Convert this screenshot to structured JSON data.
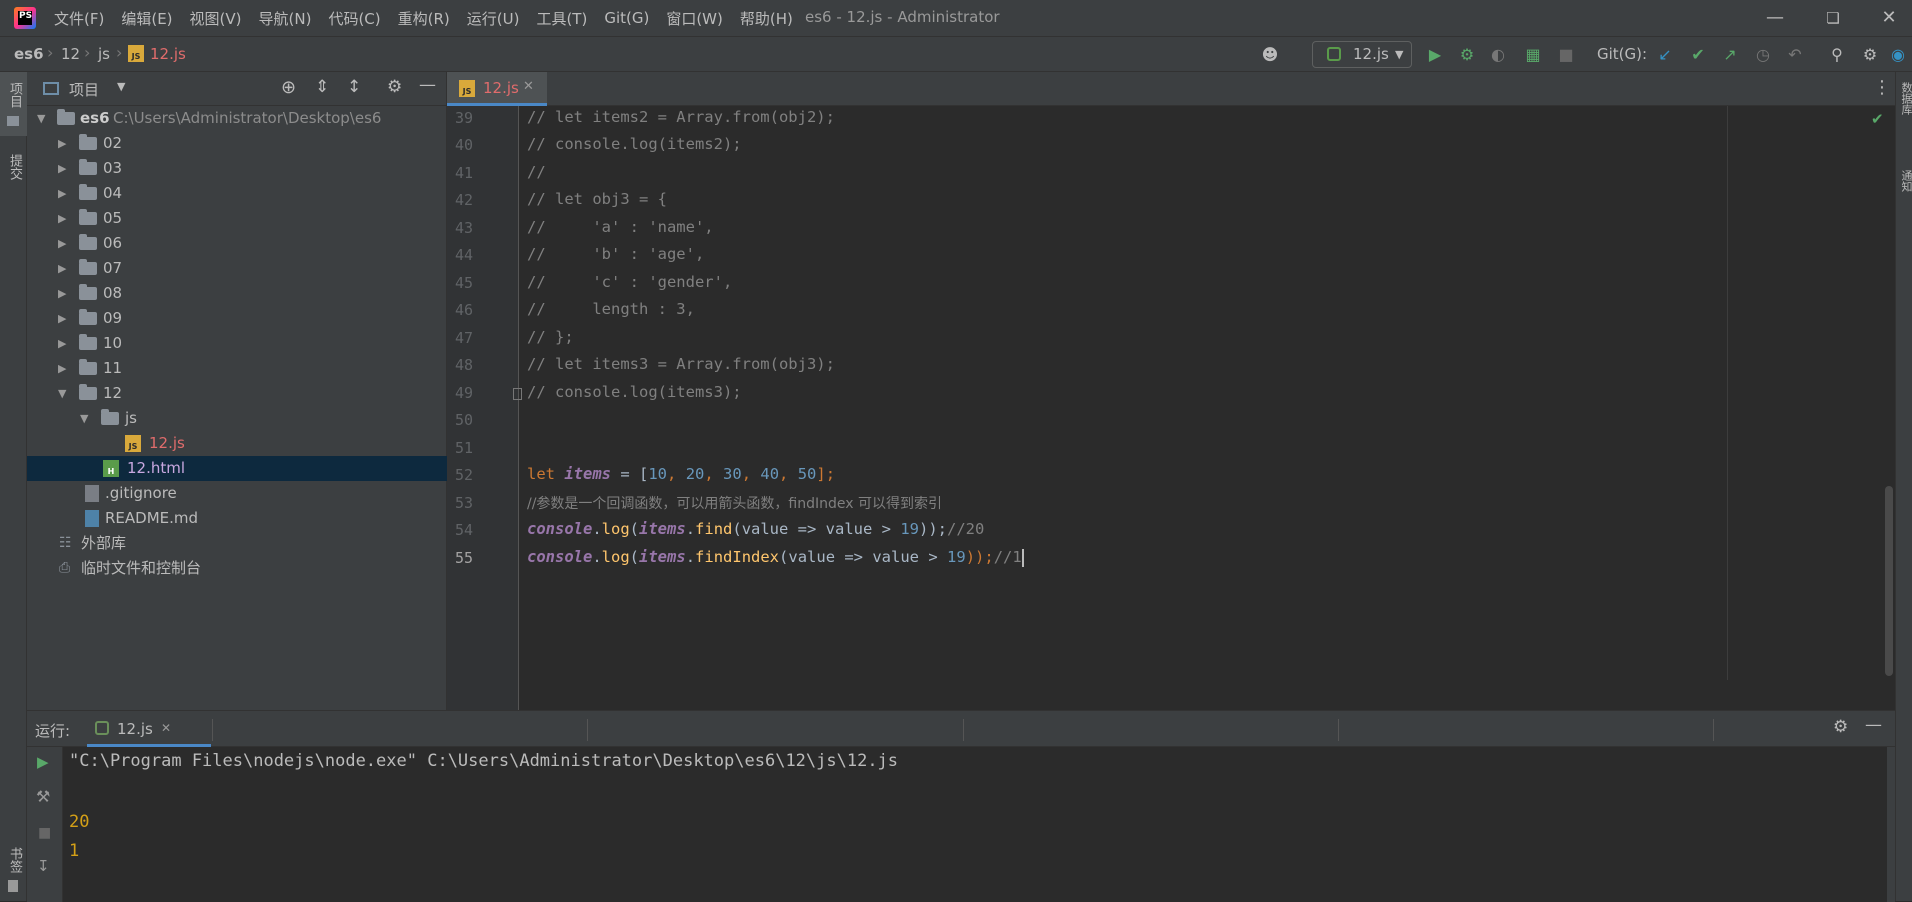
{
  "window": {
    "title": "es6 - 12.js - Administrator",
    "logo_text": "PS"
  },
  "menu": [
    "文件(F)",
    "编辑(E)",
    "视图(V)",
    "导航(N)",
    "代码(C)",
    "重构(R)",
    "运行(U)",
    "工具(T)",
    "Git(G)",
    "窗口(W)",
    "帮助(H)"
  ],
  "breadcrumb": [
    "es6",
    "12",
    "js",
    "12.js"
  ],
  "toolbar": {
    "run_config": "12.js",
    "git_label": "Git(G):"
  },
  "left_stripe": {
    "project": "项目",
    "commit": "提交",
    "bookmarks": "书签"
  },
  "right_stripe": {
    "database": "数据库",
    "notifications": "通知"
  },
  "project": {
    "title": "项目",
    "root_name": "es6",
    "root_path": "C:\\Users\\Administrator\\Desktop\\es6",
    "folders": [
      "02",
      "03",
      "04",
      "05",
      "06",
      "07",
      "08",
      "09",
      "10",
      "11",
      "12"
    ],
    "sub_folder": "js",
    "js_file": "12.js",
    "html_file": "12.html",
    "gitignore": ".gitignore",
    "readme": "README.md",
    "external_libs": "外部库",
    "scratches": "临时文件和控制台"
  },
  "editor": {
    "tab": "12.js",
    "line_numbers": [
      "39",
      "40",
      "41",
      "42",
      "43",
      "44",
      "45",
      "46",
      "47",
      "48",
      "49",
      "50",
      "51",
      "52",
      "53",
      "54",
      "55"
    ],
    "lines": {
      "l39": "// let items2 = Array.from(obj2);",
      "l40": "// console.log(items2);",
      "l41": "//",
      "l42": "// let obj3 = {",
      "l43": "//     'a' : 'name',",
      "l44": "//     'b' : 'age',",
      "l45": "//     'c' : 'gender',",
      "l46": "//     length : 3,",
      "l47": "// };",
      "l48": "// let items3 = Array.from(obj3);",
      "l49": "// console.log(items3);",
      "l53": "//参数是一个回调函数，可以用箭头函数，findIndex 可以得到索引"
    },
    "tokens": {
      "let": "let",
      "items": "items",
      "eq": " = [",
      "n10": "10",
      "n20": "20",
      "n30": "30",
      "n40": "40",
      "n50": "50",
      "comma": ", ",
      "close": "];",
      "console": "console",
      "dot": ".",
      "log": "log",
      "paren": "(",
      "find": "find",
      "findIndex": "findIndex",
      "arrow": "(value => value > ",
      "n19": "19",
      "end": "));",
      "c20": "//20",
      "c1": "//1"
    }
  },
  "run": {
    "label": "运行:",
    "tab": "12.js",
    "command": "\"C:\\Program Files\\nodejs\\node.exe\" C:\\Users\\Administrator\\Desktop\\es6\\12\\js\\12.js",
    "output": [
      "20",
      "1"
    ]
  },
  "colors": {
    "accent": "#4a88c7",
    "keyword": "#cc7832",
    "number": "#6897bb",
    "function": "#ffc66d",
    "comment": "#808080",
    "output": "#d4a017"
  }
}
